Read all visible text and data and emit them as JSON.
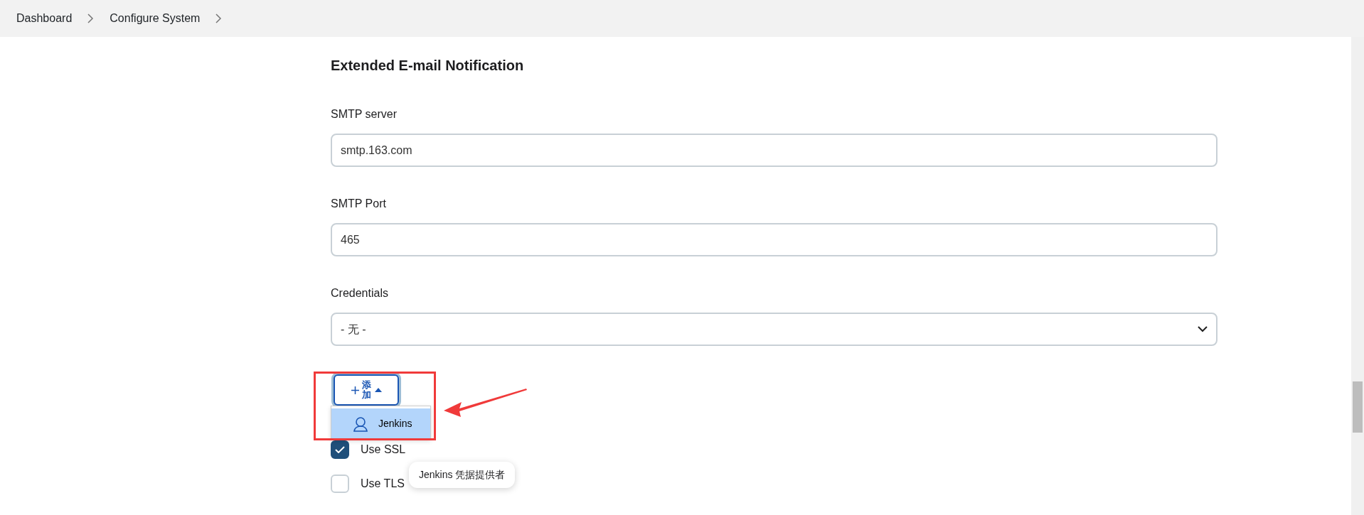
{
  "breadcrumbs": [
    {
      "label": "Dashboard"
    },
    {
      "label": "Configure System"
    }
  ],
  "section_title": "Extended E-mail Notification",
  "fields": [
    {
      "kind": "text",
      "label": "SMTP server",
      "value": "smtp.163.com"
    },
    {
      "kind": "text",
      "label": "SMTP Port",
      "value": "465"
    },
    {
      "kind": "select",
      "label": "Credentials",
      "value": "- 无 -"
    }
  ],
  "add_button": {
    "label": "添加",
    "expanded": true
  },
  "add_menu": [
    {
      "label": "Jenkins",
      "selected": true
    }
  ],
  "tooltip": "Jenkins 凭据提供者",
  "checkboxes": [
    {
      "label": "Use SSL",
      "checked": true
    },
    {
      "label": "Use TLS",
      "checked": false
    }
  ]
}
